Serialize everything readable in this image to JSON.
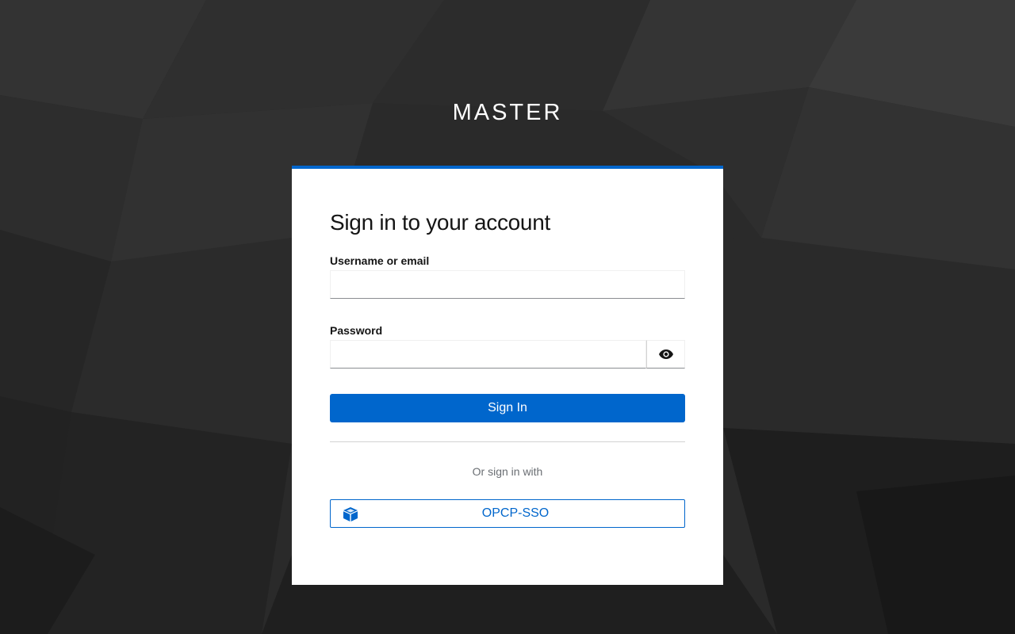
{
  "realm": {
    "title": "MASTER"
  },
  "login": {
    "heading": "Sign in to your account",
    "username": {
      "label": "Username or email",
      "value": "",
      "placeholder": ""
    },
    "password": {
      "label": "Password",
      "value": "",
      "placeholder": ""
    },
    "show_password_icon": "eye-icon",
    "sign_in_label": "Sign In",
    "divider_text": "Or sign in with",
    "providers": [
      {
        "label": "OPCP-SSO",
        "icon": "cube-icon"
      }
    ]
  },
  "colors": {
    "accent": "#0066cc",
    "background": "#262626",
    "card": "#ffffff"
  }
}
